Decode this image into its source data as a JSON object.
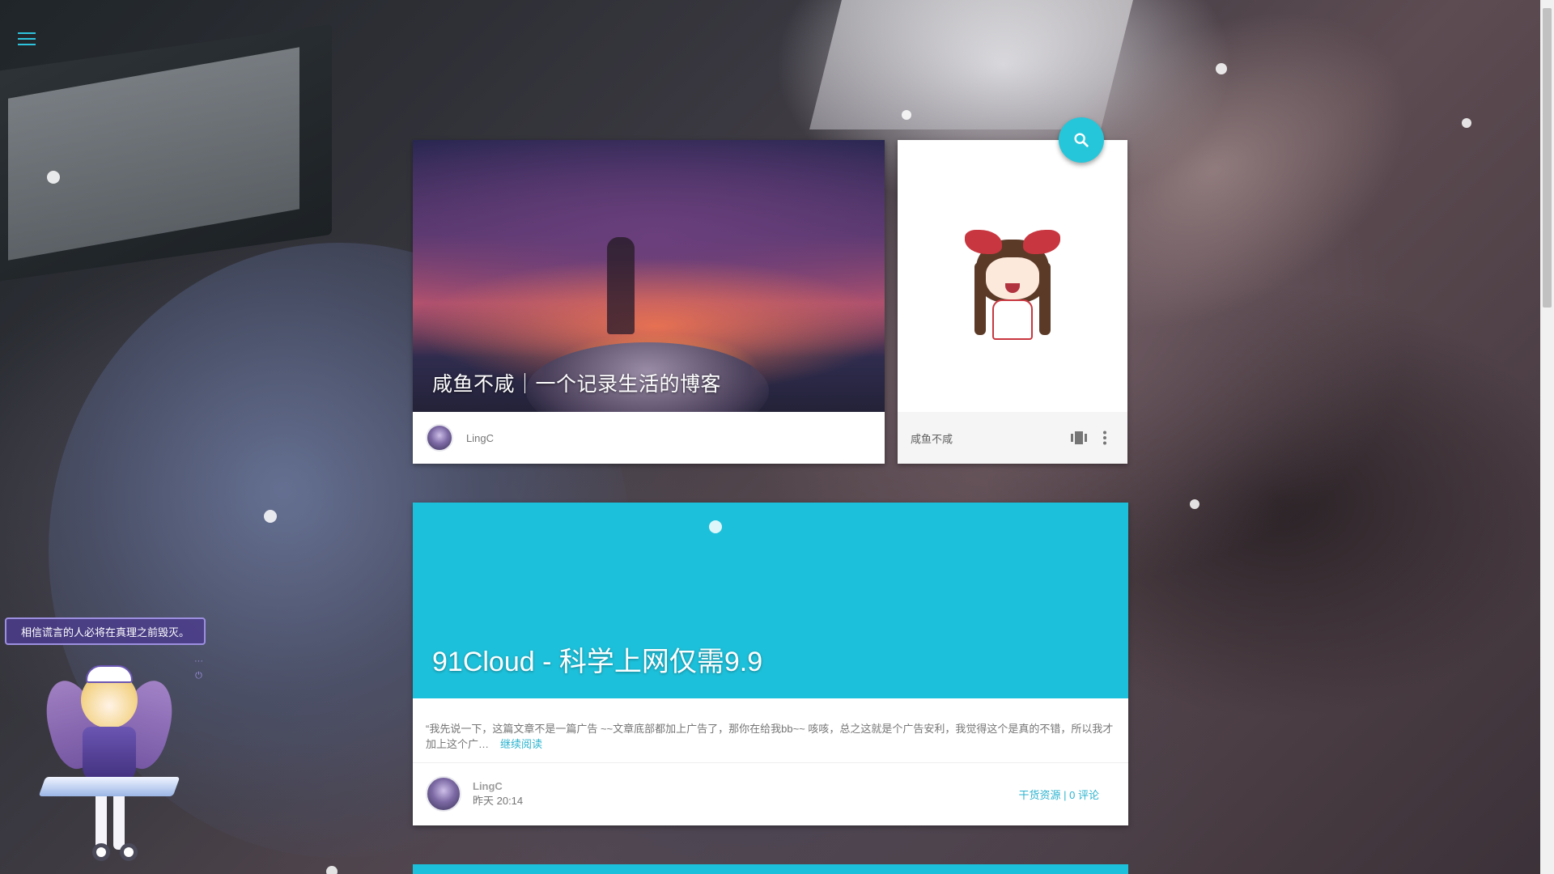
{
  "nav": {
    "menu_icon": "menu-icon"
  },
  "feature": {
    "title": "咸鱼不咸｜一个记录生活的博客",
    "author": "LingC"
  },
  "side": {
    "label": "咸鱼不咸",
    "icons": [
      "view-carousel-icon",
      "more-vert-icon"
    ]
  },
  "search": {
    "icon": "search-icon"
  },
  "post": {
    "title": "91Cloud - 科学上网仅需9.9",
    "excerpt": "“我先说一下，这篇文章不是一篇广告 ~~文章底部都加上广告了，那你在给我bb~~ 咳咳，总之这就是个广告安利，我觉得这个是真的不错，所以我才加上这个广…",
    "read_more": "继续阅读",
    "author": "LingC",
    "time": "昨天 20:14",
    "category": "干货资源",
    "separator": " | ",
    "comments": "0 评论"
  },
  "mascot": {
    "speech": "相信谎言的人必将在真理之前毁灭。",
    "tools": [
      "···",
      "⏻"
    ]
  },
  "colors": {
    "accent": "#26c6da",
    "post_header": "#1dc0da",
    "link": "#2bb3cf"
  }
}
